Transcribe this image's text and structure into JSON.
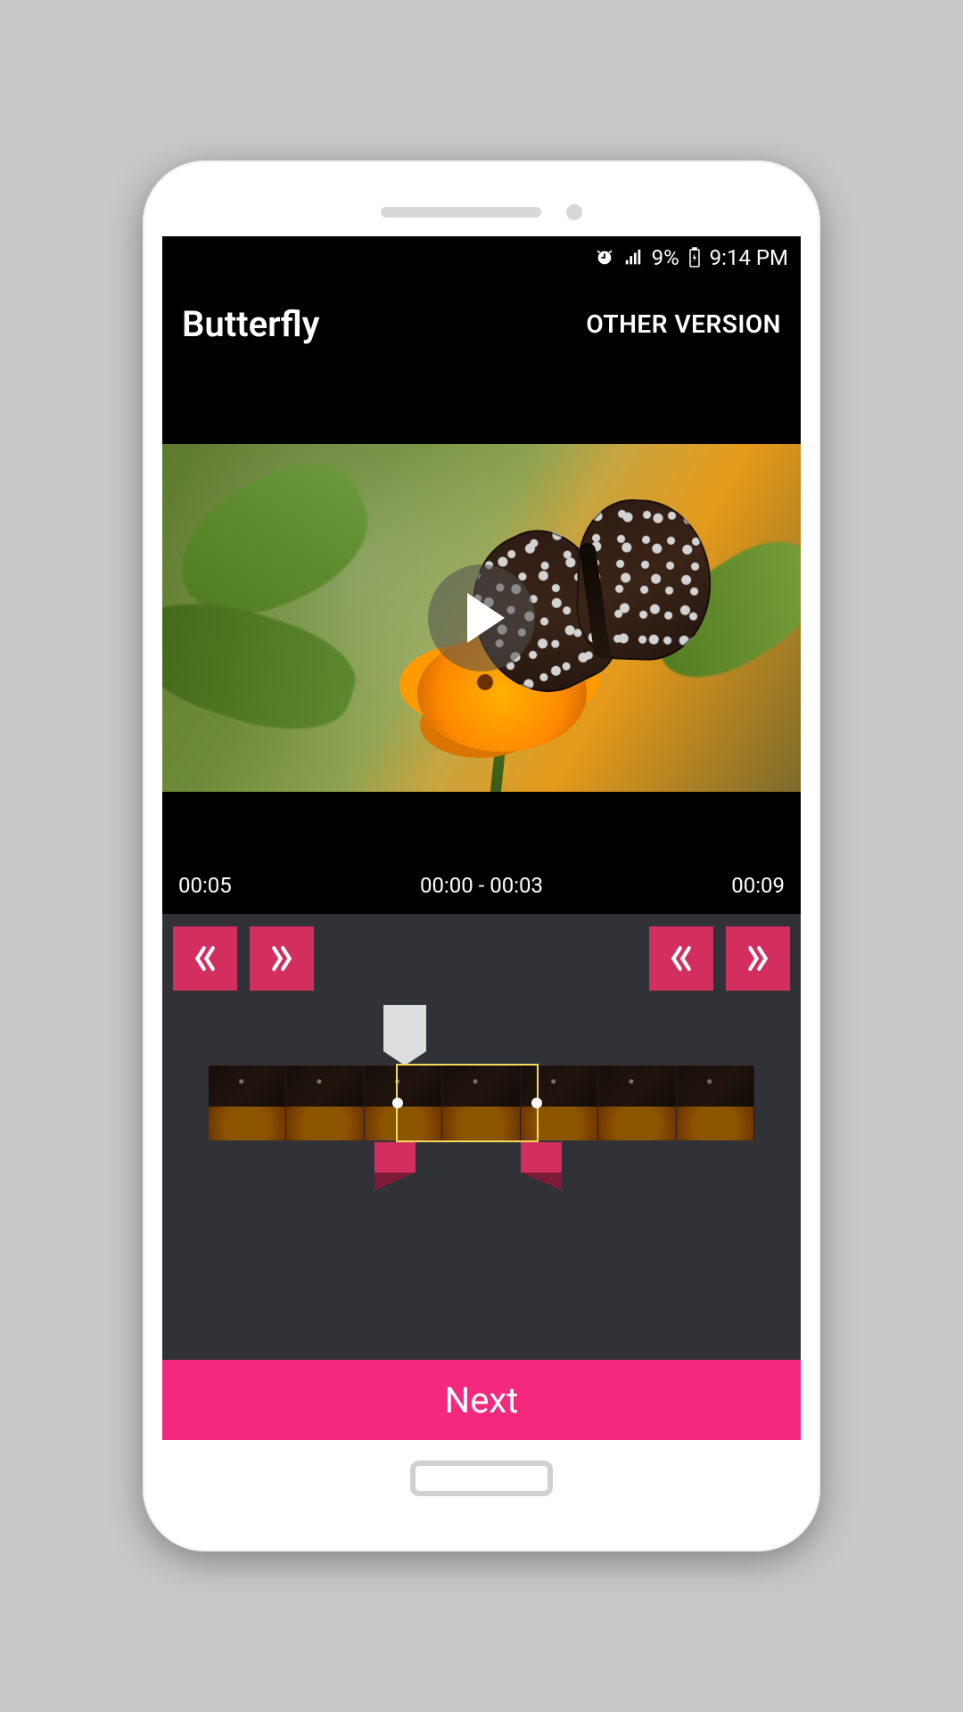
{
  "status": {
    "battery_pct": "9%",
    "time": "9:14 PM"
  },
  "title": "Butterfly",
  "other_version": "OTHER VERSION",
  "time_labels": {
    "left": "00:05",
    "center": "00:00 - 00:03",
    "right": "00:09"
  },
  "next_button": "Next"
}
